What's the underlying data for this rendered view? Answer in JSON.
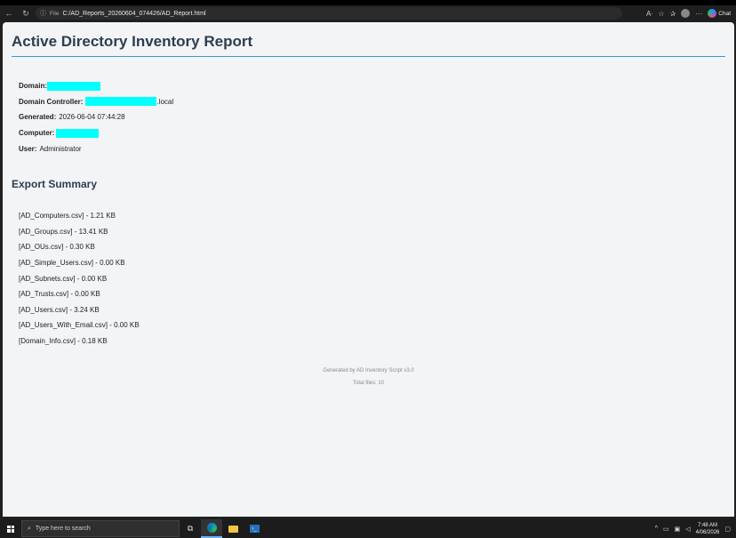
{
  "browser": {
    "url_scheme": "File",
    "url_path": "C:/AD_Reports_20260604_074426/AD_Report.html",
    "chat_label": "Chat"
  },
  "report": {
    "title": "Active Directory Inventory Report",
    "info": {
      "domain_label": "Domain:",
      "dc_label": "Domain Controller:",
      "dc_suffix": ".local",
      "generated_label": "Generated:",
      "generated_value": "2026-06-04 07:44:28",
      "computer_label": "Computer:",
      "user_label": "User:",
      "user_value": "Administrator"
    },
    "summary_title": "Export Summary",
    "files": [
      "[AD_Computers.csv] - 1.21 KB",
      "[AD_Groups.csv] - 13.41 KB",
      "[AD_OUs.csv] - 0.30 KB",
      "[AD_Simple_Users.csv] - 0.00 KB",
      "[AD_Subnets.csv] - 0.00 KB",
      "[AD_Trusts.csv] - 0.00 KB",
      "[AD_Users.csv] - 3.24 KB",
      "[AD_Users_With_Email.csv] - 0.00 KB",
      "[Domain_Info.csv] - 0.18 KB"
    ],
    "footer_generated": "Generated by AD Inventory Script v3.0",
    "footer_total": "Total files: 10"
  },
  "taskbar": {
    "search_placeholder": "Type here to search",
    "time": "7:48 AM",
    "date": "4/06/2026"
  },
  "colors": {
    "title": "#2c3e50",
    "accent_rule": "#3498db",
    "redaction": "#00ffff"
  }
}
